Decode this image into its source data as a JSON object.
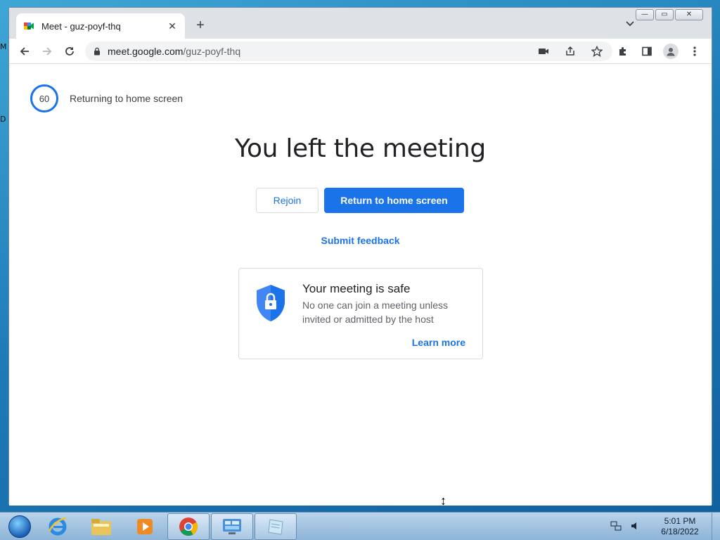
{
  "desktop": {
    "edge_letters": [
      "M",
      "D"
    ]
  },
  "window": {
    "controls": {
      "minimize": "—",
      "maximize": "▭",
      "close": "✕"
    }
  },
  "tab": {
    "title": "Meet - guz-poyf-thq",
    "close": "✕",
    "new_tab": "+"
  },
  "toolbar": {
    "url_host": "meet.google.com",
    "url_path": "/guz-poyf-thq",
    "icons": [
      "back-icon",
      "forward-icon",
      "reload-icon",
      "lock-icon",
      "camera-icon",
      "share-icon",
      "star-icon",
      "extensions-icon",
      "side-panel-icon",
      "profile-icon",
      "menu-icon"
    ]
  },
  "page": {
    "countdown_value": "60",
    "countdown_text": "Returning to home screen",
    "headline": "You left the meeting",
    "rejoin_label": "Rejoin",
    "return_label": "Return to home screen",
    "feedback_label": "Submit feedback",
    "safe_title": "Your meeting is safe",
    "safe_desc": "No one can join a meeting unless invited or admitted by the host",
    "learn_more": "Learn more"
  },
  "colors": {
    "accent": "#1a73e8",
    "text": "#202124",
    "muted": "#5f6368"
  },
  "taskbar": {
    "apps": [
      "start-orb",
      "internet-explorer",
      "file-explorer",
      "media-player",
      "chrome",
      "control-panel",
      "notepad"
    ],
    "clock_time": "5:01 PM",
    "clock_date": "6/18/2022"
  }
}
